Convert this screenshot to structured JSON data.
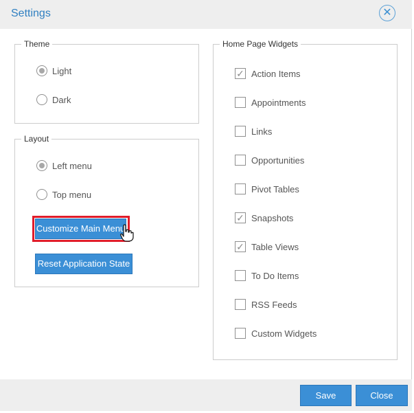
{
  "dialog": {
    "title": "Settings",
    "close_symbol": "✕"
  },
  "theme": {
    "legend": "Theme",
    "options": [
      {
        "label": "Light",
        "selected": true
      },
      {
        "label": "Dark",
        "selected": false
      }
    ]
  },
  "layout": {
    "legend": "Layout",
    "options": [
      {
        "label": "Left menu",
        "selected": true
      },
      {
        "label": "Top menu",
        "selected": false
      }
    ],
    "customize_label": "Customize Main Menu",
    "reset_label": "Reset Application State"
  },
  "widgets": {
    "legend": "Home Page Widgets",
    "items": [
      {
        "label": "Action Items",
        "checked": true
      },
      {
        "label": "Appointments",
        "checked": false
      },
      {
        "label": "Links",
        "checked": false
      },
      {
        "label": "Opportunities",
        "checked": false
      },
      {
        "label": "Pivot Tables",
        "checked": false
      },
      {
        "label": "Snapshots",
        "checked": true
      },
      {
        "label": "Table Views",
        "checked": true
      },
      {
        "label": "To Do Items",
        "checked": false
      },
      {
        "label": "RSS Feeds",
        "checked": false
      },
      {
        "label": "Custom Widgets",
        "checked": false
      }
    ],
    "check_symbol": "✓"
  },
  "footer": {
    "save_label": "Save",
    "close_label": "Close"
  },
  "colors": {
    "accent": "#3b8fd6",
    "highlight": "#e01c2a",
    "title": "#2f7fc1"
  }
}
